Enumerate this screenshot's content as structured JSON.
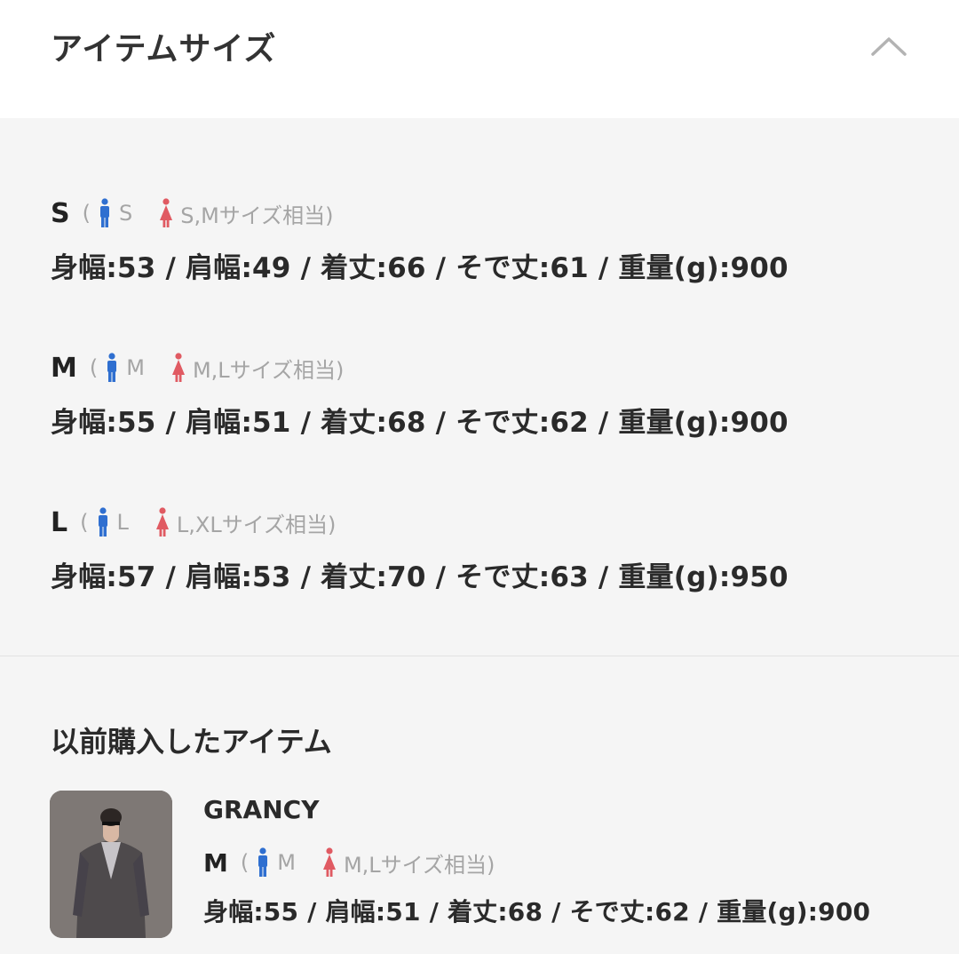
{
  "header": {
    "title": "アイテムサイズ",
    "collapse_icon": "chevron-up-icon"
  },
  "colors": {
    "male": "#2f6fd0",
    "female": "#e05a62",
    "muted": "#a5a5a5"
  },
  "sizes": [
    {
      "code": "S",
      "open": "(",
      "male": "S",
      "female": "S,Mサイズ相当)",
      "measurements": "身幅:53 / 肩幅:49 / 着丈:66 / そで丈:61 / 重量(g):900"
    },
    {
      "code": "M",
      "open": "(",
      "male": "M",
      "female": "M,Lサイズ相当)",
      "measurements": "身幅:55 / 肩幅:51 / 着丈:68 / そで丈:62 / 重量(g):900"
    },
    {
      "code": "L",
      "open": "(",
      "male": "L",
      "female": "L,XLサイズ相当)",
      "measurements": "身幅:57 / 肩幅:53 / 着丈:70 / そで丈:63 / 重量(g):950"
    }
  ],
  "previous": {
    "title": "以前購入したアイテム",
    "brand": "GRANCY",
    "size": {
      "code": "M",
      "open": "(",
      "male": "M",
      "female": "M,Lサイズ相当)",
      "measurements": "身幅:55 / 肩幅:51 / 着丈:68 / そで丈:62 / 重量(g):900"
    }
  }
}
